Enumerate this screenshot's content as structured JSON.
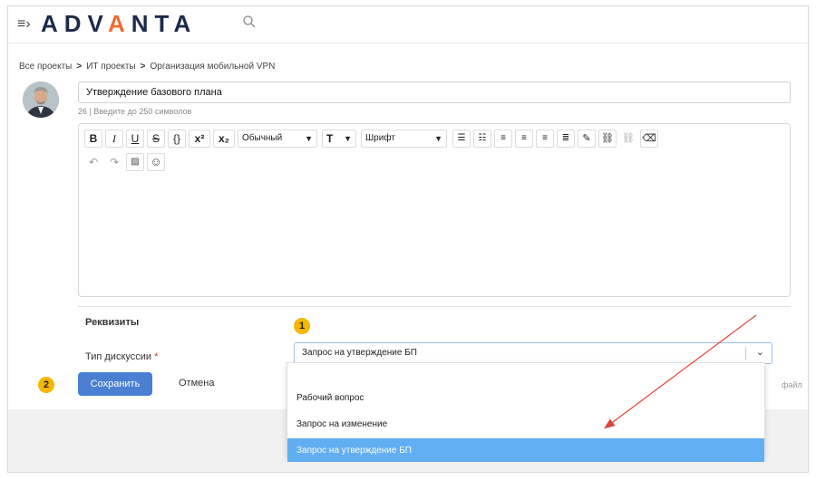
{
  "header": {
    "logo_pre": "ADV",
    "logo_accent": "A",
    "logo_post": "NTA"
  },
  "breadcrumb": {
    "items": [
      "Все проекты",
      "ИТ проекты",
      "Организация мобильной VPN"
    ],
    "separator": ">"
  },
  "form": {
    "title_value": "Утверждение базового плана",
    "title_hint": "26 | Введите до 250 символов"
  },
  "editor": {
    "bold": "B",
    "italic": "I",
    "underline": "U",
    "strike": "S",
    "code": "{}",
    "superscript": "x²",
    "subscript": "x₂",
    "paragraph_style": "Обычный",
    "text_size": "T",
    "font": "Шрифт",
    "undo": "↶",
    "redo": "↷"
  },
  "section": {
    "title": "Реквизиты",
    "type_label": "Тип дискуссии",
    "required_mark": "*"
  },
  "select": {
    "value": "Запрос на утверждение БП"
  },
  "dropdown": {
    "options": [
      "Рабочий вопрос",
      "Запрос на изменение",
      "Запрос на утверждение БП"
    ],
    "selected_index": 2
  },
  "actions": {
    "save": "Сохранить",
    "cancel": "Отмена",
    "file_fragment": "файл"
  },
  "annotations": {
    "badge1": "1",
    "badge2": "2",
    "arrow_color": "#e0453a"
  },
  "colors": {
    "accent": "#4a7fd1",
    "logo_accent": "#ef6c33",
    "selected_option": "#62aef2",
    "badge": "#f5b700"
  }
}
